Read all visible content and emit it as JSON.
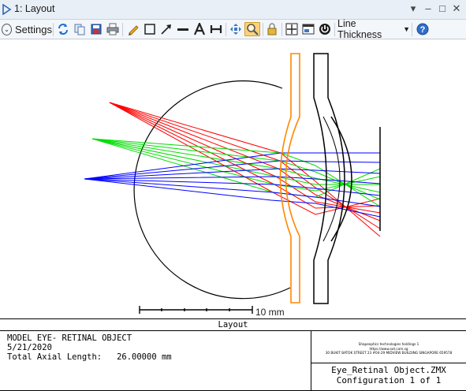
{
  "window": {
    "title": "1: Layout",
    "controls": [
      "▾",
      "–",
      "□",
      "✕"
    ]
  },
  "toolbar": {
    "settings_label": "Settings",
    "line_thickness_label": "Line Thickness",
    "icons": [
      "refresh-icon",
      "copy-icon",
      "save-icon",
      "print-icon",
      "pencil-icon",
      "rectangle-icon",
      "arrow-icon",
      "line-icon",
      "text-icon",
      "dimension-icon",
      "pan-icon",
      "zoom-icon",
      "lock-icon",
      "fit-icon",
      "window-icon",
      "reset-icon",
      "help-icon"
    ]
  },
  "scale_bar": {
    "label": "10 mm"
  },
  "caption": "Layout",
  "info": {
    "line1": "MODEL EYE- RETINAL OBJECT",
    "line2": "5/21/2020",
    "line3": "Total Axial Length:   26.00000 mm"
  },
  "company": {
    "line1": "Shapeoptics technologies holdings 1",
    "line2": "https://www.sot.com.sg",
    "line3": "30 BUKIT BATOK STREET 23 #04-29 MIDVIEW BUILDING SINGAPORE 659578"
  },
  "file": {
    "name": "Eye_Retinal Object.ZMX",
    "config": "Configuration 1 of 1"
  },
  "colors": {
    "ray_red": "#ff0000",
    "ray_green": "#00dd00",
    "ray_blue": "#0000ff",
    "lens_orange": "#ff8800",
    "titlebar_bg": "#e9eff6",
    "toolbar_bg": "#f3f6fa",
    "zoom_active": "#f9d27a"
  }
}
